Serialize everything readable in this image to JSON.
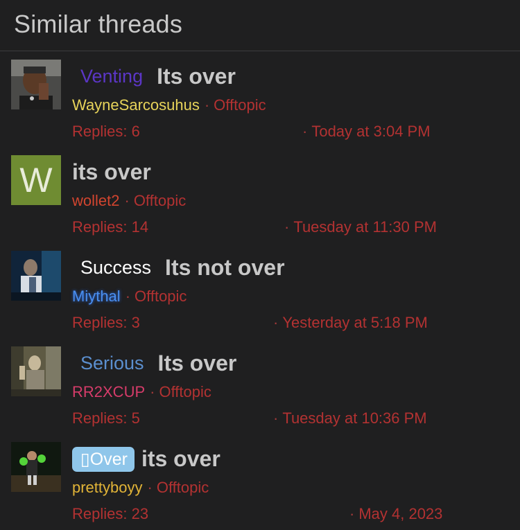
{
  "header": {
    "title": "Similar threads"
  },
  "threads": [
    {
      "prefix": "Venting",
      "prefix_color": "#5b36c6",
      "title": "Its over",
      "author": "WayneSarcosuhus",
      "author_color": "#e7d35a",
      "forum": "Offtopic",
      "replies": "Replies: 6",
      "date": "Today at 3:04 PM"
    },
    {
      "prefix": "",
      "avatar_letter": "W",
      "title": "its over",
      "author": "wollet2",
      "author_color": "#d2452f",
      "forum": "Offtopic",
      "replies": "Replies: 14",
      "date": "Tuesday at 11:30 PM"
    },
    {
      "prefix": "Success",
      "prefix_color": "#ffffff",
      "title": "Its not over",
      "author": "Miythal",
      "author_color": "#4a8ff0",
      "forum": "Offtopic",
      "replies": "Replies: 3",
      "date": "Yesterday at 5:18 PM"
    },
    {
      "prefix": "Serious",
      "prefix_color": "#5b8fcf",
      "title": "Its over",
      "author": "RR2XCUP",
      "author_color": "#d63c6a",
      "forum": "Offtopic",
      "replies": "Replies: 5",
      "date": "Tuesday at 10:36 PM"
    },
    {
      "prefix": "▯Over",
      "prefix_color": "#ffffff",
      "title": "its over",
      "author": "prettyboyy",
      "author_color": "#e2b437",
      "forum": "Offtopic",
      "replies": "Replies: 23",
      "date": "May 4, 2023"
    }
  ]
}
